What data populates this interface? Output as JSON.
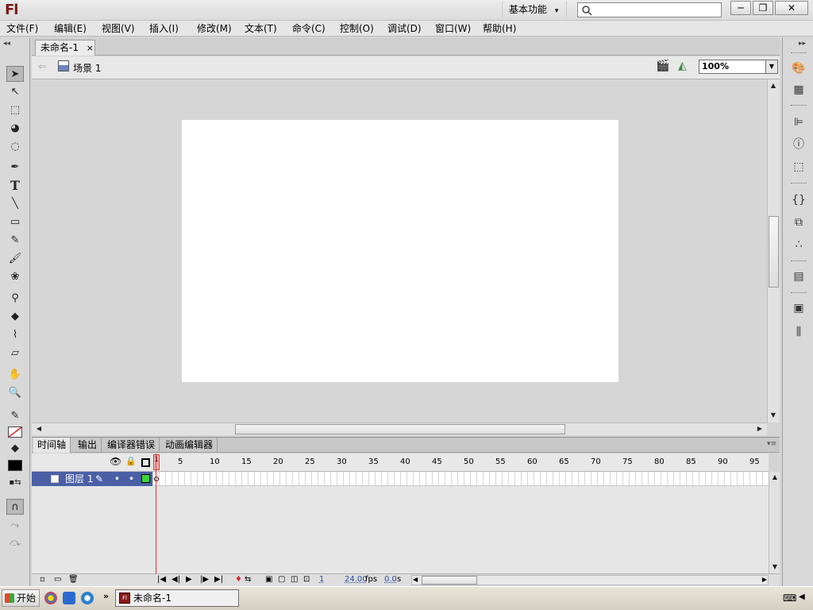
{
  "app": {
    "logo": "Fl"
  },
  "titlebar": {
    "workspace": "基本功能",
    "workspace_arrow": "▾",
    "search_placeholder": "",
    "minimize": "─",
    "restore": "❐",
    "close": "✕"
  },
  "menu": {
    "items": [
      "文件(F)",
      "编辑(E)",
      "视图(V)",
      "插入(I)",
      "修改(M)",
      "文本(T)",
      "命令(C)",
      "控制(O)",
      "调试(D)",
      "窗口(W)",
      "帮助(H)"
    ]
  },
  "document": {
    "tab_label": "未命名-1",
    "tab_close": "×",
    "scene_label": "场景 1",
    "zoom": "100%"
  },
  "timeline": {
    "tabs": [
      "时间轴",
      "输出",
      "编译器错误",
      "动画编辑器"
    ],
    "frame_ticks": [
      "1",
      "5",
      "10",
      "15",
      "20",
      "25",
      "30",
      "35",
      "40",
      "45",
      "50",
      "55",
      "60",
      "65",
      "70",
      "75",
      "80",
      "85",
      "90",
      "95"
    ],
    "layer_name": "图层 1",
    "current_frame": "1",
    "fps": "24.00",
    "fps_unit": "fps",
    "time": "0.0",
    "time_unit": "s"
  },
  "taskbar": {
    "start_label": "开始",
    "task_label": "未命名-1"
  },
  "colors": {
    "accent_layer": "#4a5fa6",
    "playhead": "#e23030",
    "stage": "#ffffff",
    "pasteboard": "#d6d6d6"
  }
}
